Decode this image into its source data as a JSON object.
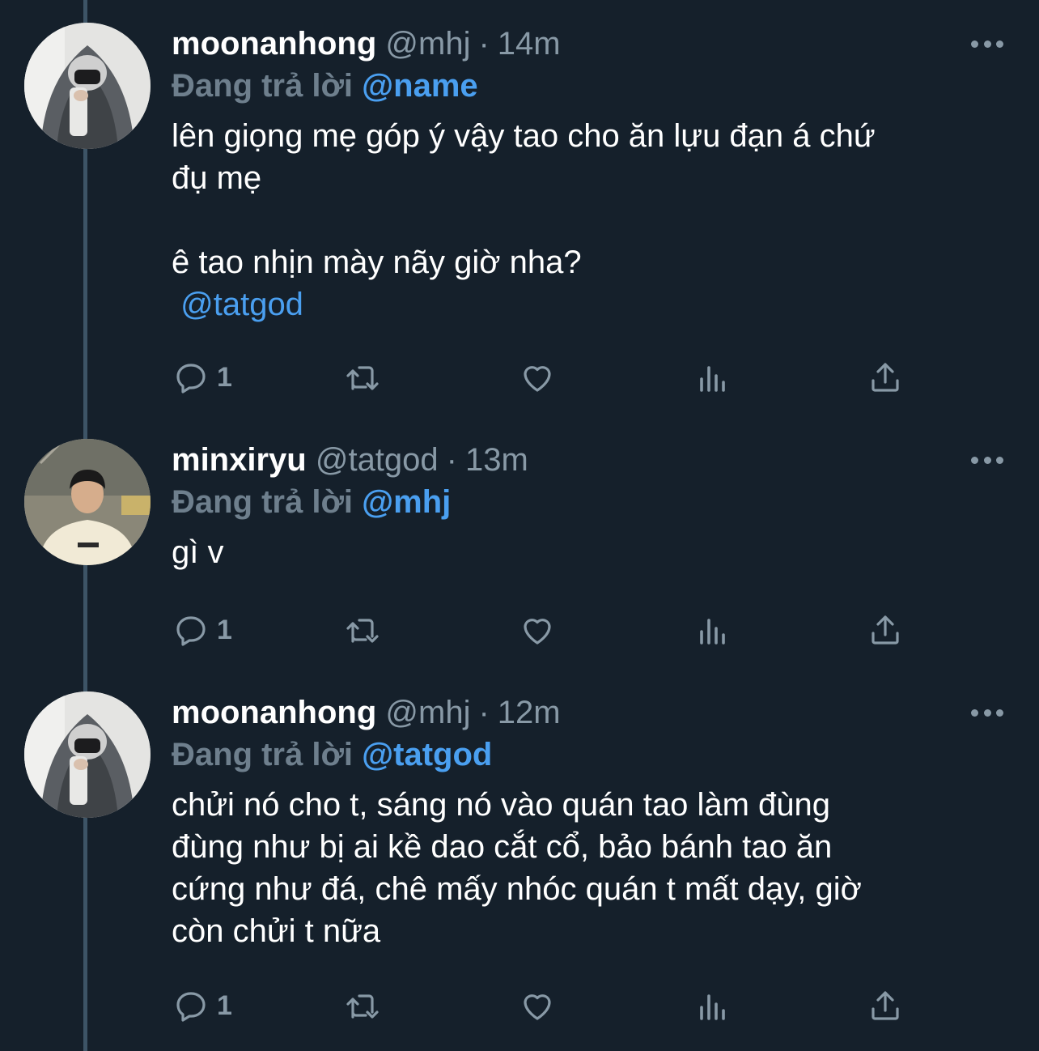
{
  "colors": {
    "background": "#15202b",
    "secondary_text": "#8899a6",
    "link": "#4a9ff0",
    "thread_line": "#3d5466"
  },
  "tweets": [
    {
      "display_name": "moonanhong",
      "handle": "@mhj",
      "separator": "·",
      "time": "14m",
      "reply_prefix": "Đang trả lời",
      "reply_to": "@name",
      "body_lines": [
        "lên giọng mẹ góp ý vậy tao cho ăn lựu đạn á chứ",
        "đụ mẹ",
        "",
        "ê tao nhịn mày nãy giờ nha?"
      ],
      "mention": " @tatgod",
      "reply_count": "1",
      "avatar": "avatar-hooded-masked"
    },
    {
      "display_name": "minxiryu",
      "handle": "@tatgod",
      "separator": "·",
      "time": "13m",
      "reply_prefix": "Đang trả lời",
      "reply_to": "@mhj",
      "body_lines": [
        "gì v"
      ],
      "mention": "",
      "reply_count": "1",
      "avatar": "avatar-person-cream-shirt"
    },
    {
      "display_name": "moonanhong",
      "handle": "@mhj",
      "separator": "·",
      "time": "12m",
      "reply_prefix": "Đang trả lời",
      "reply_to": "@tatgod",
      "body_lines": [
        "chửi nó cho t, sáng nó vào quán tao làm đùng",
        "đùng như bị ai kề dao cắt cổ, bảo bánh tao ăn",
        "cứng như đá, chê mấy nhóc quán t mất dạy, giờ",
        "còn chửi t nữa"
      ],
      "mention": "",
      "reply_count": "1",
      "avatar": "avatar-hooded-masked"
    }
  ],
  "action_icons": [
    "reply-icon",
    "retweet-icon",
    "like-icon",
    "analytics-icon",
    "share-icon",
    "more-icon"
  ]
}
